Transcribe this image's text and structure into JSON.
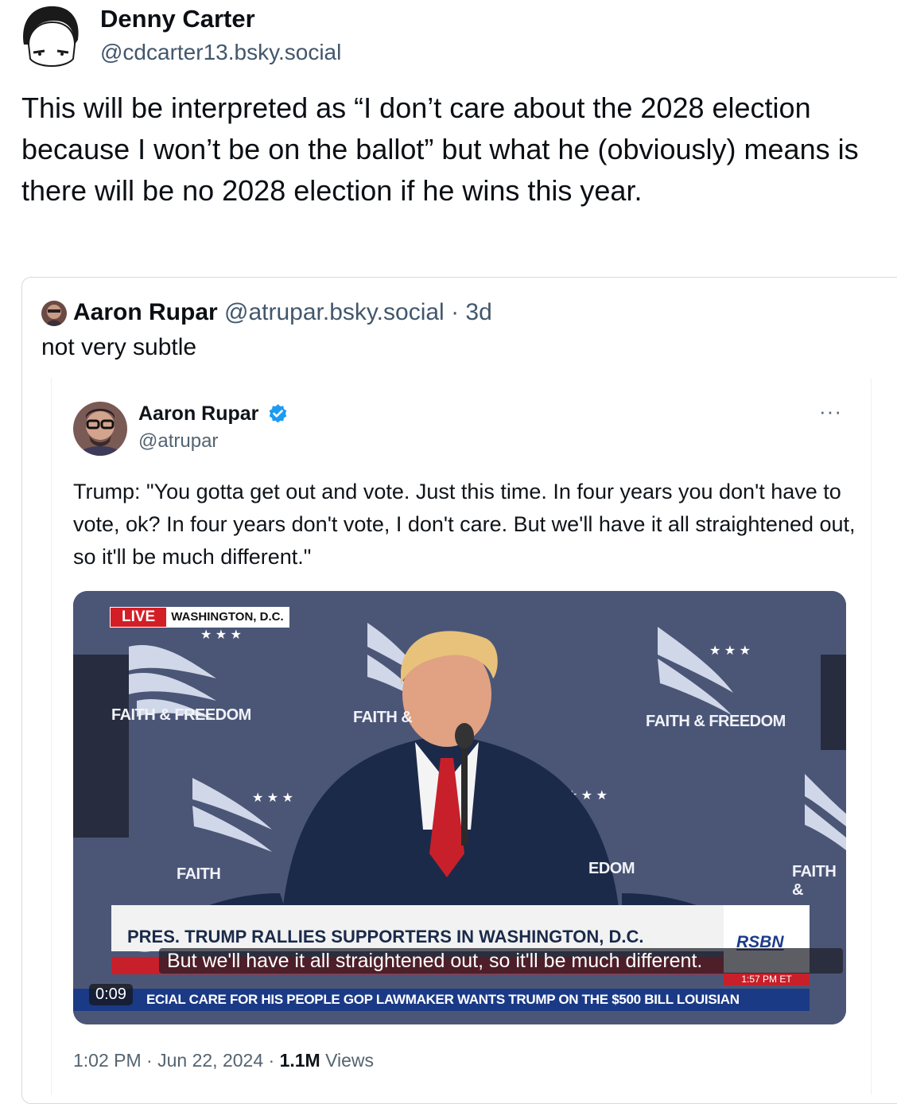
{
  "post": {
    "author_name": "Denny Carter",
    "author_handle": "@cdcarter13.bsky.social",
    "text": "This will be interpreted as “I don’t care about the 2028 election because I won’t be on the ballot” but what he (obviously) means is there will be no 2028 election if he wins this year."
  },
  "quote": {
    "author_name": "Aaron Rupar",
    "author_handle": "@atrupar.bsky.social",
    "separator": "·",
    "age": "3d",
    "text": "not very subtle"
  },
  "tweet": {
    "author_name": "Aaron Rupar",
    "author_handle": "@atrupar",
    "more_label": "···",
    "text": "Trump: \"You gotta get out and vote. Just this time. In four years you don't have to vote, ok? In four years don't vote, I don't care. But we'll have it all straightened out, so it'll be much different.\"",
    "time": "1:02 PM",
    "date": "Jun 22, 2024",
    "views_count": "1.1M",
    "views_label": "Views",
    "dot": "·"
  },
  "video": {
    "live_label": "LIVE",
    "location": "WASHINGTON, D.C.",
    "backdrop_labels": [
      "FAITH & FREEDOM",
      "FAITH &",
      "FAITH & FREEDOM",
      "FAITH",
      "EDOM",
      "FAITH &"
    ],
    "headline": "PRES. TRUMP RALLIES SUPPORTERS IN WASHINGTON, D.C.",
    "caption": "But we'll have it all straightened out, so it'll be much different.",
    "network_logo": "RSBN",
    "clock": "1:57 PM ET",
    "ticker": "ECIAL CARE FOR HIS PEOPLE    GOP LAWMAKER WANTS TRUMP ON THE $500 BILL    LOUISIAN",
    "timestamp": "0:09"
  }
}
